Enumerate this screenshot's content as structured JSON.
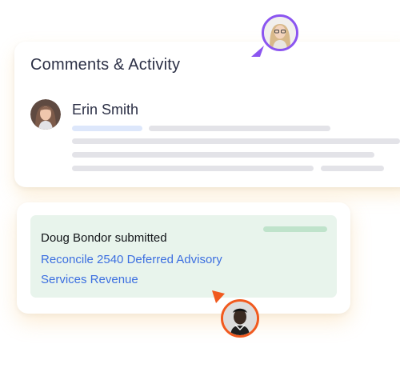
{
  "comments_card": {
    "title": "Comments & Activity",
    "commenter": {
      "name": "Erin Smith"
    }
  },
  "submission_card": {
    "submitter_text": "Doug Bondor submitted",
    "task_link": "Reconcile 2540 Deferred Advisory Services Revenue"
  },
  "colors": {
    "accent_purple": "#8b55f0",
    "accent_orange": "#f05a1f",
    "link_blue": "#3c6fe0",
    "success_bg": "#e8f4ec"
  },
  "icons": {
    "purple_cursor": "cursor-arrow-icon",
    "orange_cursor": "cursor-arrow-icon"
  }
}
